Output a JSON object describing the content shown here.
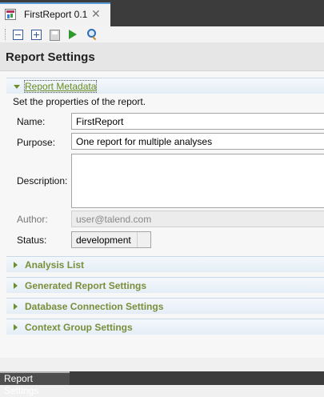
{
  "editor_tab": {
    "title": "FirstReport 0.1",
    "close_glyph": "✕"
  },
  "toolbar": {
    "icons": [
      "collapse-all-icon",
      "expand-all-icon",
      "save-icon",
      "run-icon",
      "preview-icon"
    ]
  },
  "header": {
    "title": "Report Settings"
  },
  "sections": {
    "report_metadata": {
      "label": "Report Metadata",
      "expanded": true,
      "hint": "Set the properties of the report.",
      "fields": {
        "name": {
          "label": "Name:",
          "value": "FirstReport"
        },
        "purpose": {
          "label": "Purpose:",
          "value": "One report for multiple analyses"
        },
        "description": {
          "label": "Description:",
          "value": ""
        },
        "author": {
          "label": "Author:",
          "value": "user@talend.com"
        },
        "status": {
          "label": "Status:",
          "value": "development"
        }
      }
    },
    "analysis_list": {
      "label": "Analysis List",
      "expanded": false
    },
    "generated_report_settings": {
      "label": "Generated Report Settings",
      "expanded": false
    },
    "database_connection_settings": {
      "label": "Database Connection Settings",
      "expanded": false
    },
    "context_group_settings": {
      "label": "Context Group Settings",
      "expanded": false
    }
  },
  "footer": {
    "tab_label": "Report Settings"
  },
  "colors": {
    "section_label": "#7a8f3a",
    "tab_accent": "#5a9ad6",
    "dark_chrome": "#3c3c3c"
  }
}
